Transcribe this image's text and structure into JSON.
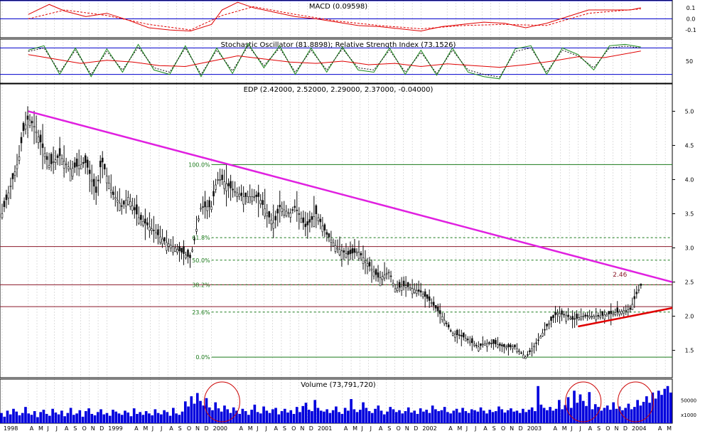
{
  "chart_data": [
    {
      "panel": "macd",
      "type": "line",
      "title": "MACD (0.09598)",
      "y_ticks": [
        "0.1",
        "0.0",
        "-0.1"
      ],
      "yticks_values": [
        0.1,
        0.0,
        -0.1
      ],
      "ylim": [
        -0.17,
        0.17
      ],
      "series": [
        {
          "style": "solid",
          "color": "#e00000",
          "x": [
            1998.25,
            1998.45,
            1998.6,
            1998.8,
            1999.0,
            1999.2,
            1999.4,
            1999.6,
            1999.8,
            2000.0,
            2000.1,
            2000.25,
            2000.4,
            2000.6,
            2000.8,
            2001.0,
            2001.2,
            2001.4,
            2001.6,
            2001.8,
            2002.0,
            2002.2,
            2002.4,
            2002.6,
            2002.8,
            2003.0,
            2003.2,
            2003.4,
            2003.6,
            2003.8,
            2004.0,
            2004.1
          ],
          "values": [
            0.04,
            0.13,
            0.07,
            0.02,
            0.05,
            -0.01,
            -0.08,
            -0.1,
            -0.11,
            -0.05,
            0.08,
            0.15,
            0.1,
            0.06,
            0.02,
            0.0,
            -0.03,
            -0.06,
            -0.07,
            -0.09,
            -0.11,
            -0.07,
            -0.05,
            -0.03,
            -0.04,
            -0.08,
            -0.04,
            0.02,
            0.08,
            0.08,
            0.08,
            0.1
          ]
        },
        {
          "style": "dashed",
          "color": "#e00000",
          "x": [
            1998.25,
            1998.6,
            1999.0,
            1999.4,
            1999.8,
            2000.1,
            2000.4,
            2000.8,
            2001.2,
            2001.6,
            2002.0,
            2002.4,
            2002.8,
            2003.2,
            2003.6,
            2004.1
          ],
          "values": [
            0.0,
            0.08,
            0.03,
            -0.05,
            -0.1,
            0.03,
            0.11,
            0.04,
            -0.02,
            -0.06,
            -0.09,
            -0.06,
            -0.05,
            -0.06,
            0.05,
            0.09
          ]
        }
      ]
    },
    {
      "panel": "oscillators",
      "type": "line",
      "title": "Stochastic Oscillator (81.8898); Relative Strength Index (73.1526)",
      "y_ticks": [
        "50"
      ],
      "yticks_values": [
        50
      ],
      "ylim": [
        0,
        100
      ],
      "reference_lines": [
        80,
        20
      ],
      "series": [
        {
          "style": "solid",
          "color": "#1a8a1a",
          "x": [
            1998.25,
            1998.4,
            1998.55,
            1998.7,
            1998.85,
            1999.0,
            1999.15,
            1999.3,
            1999.45,
            1999.6,
            1999.75,
            1999.9,
            2000.05,
            2000.2,
            2000.35,
            2000.5,
            2000.65,
            2000.8,
            2000.95,
            2001.1,
            2001.25,
            2001.4,
            2001.55,
            2001.7,
            2001.85,
            2002.0,
            2002.15,
            2002.3,
            2002.45,
            2002.6,
            2002.75,
            2002.9,
            2003.05,
            2003.2,
            2003.35,
            2003.5,
            2003.65,
            2003.8,
            2003.95,
            2004.1
          ],
          "values": [
            75,
            85,
            20,
            80,
            15,
            78,
            25,
            88,
            30,
            20,
            85,
            15,
            80,
            22,
            90,
            35,
            85,
            20,
            80,
            25,
            82,
            30,
            25,
            80,
            20,
            75,
            18,
            80,
            25,
            15,
            10,
            78,
            85,
            20,
            80,
            65,
            30,
            85,
            88,
            82
          ]
        },
        {
          "style": "dashed",
          "color": "#111111",
          "x": [
            1998.25,
            1998.4,
            1998.55,
            1998.7,
            1998.85,
            1999.0,
            1999.15,
            1999.3,
            1999.45,
            1999.6,
            1999.75,
            1999.9,
            2000.05,
            2000.2,
            2000.35,
            2000.5,
            2000.65,
            2000.8,
            2000.95,
            2001.1,
            2001.25,
            2001.4,
            2001.55,
            2001.7,
            2001.85,
            2002.0,
            2002.15,
            2002.3,
            2002.45,
            2002.6,
            2002.75,
            2002.9,
            2003.05,
            2003.2,
            2003.35,
            2003.5,
            2003.65,
            2003.8,
            2003.95,
            2004.1
          ],
          "values": [
            72,
            80,
            25,
            75,
            20,
            72,
            30,
            82,
            35,
            25,
            80,
            20,
            75,
            28,
            85,
            40,
            80,
            25,
            75,
            30,
            78,
            35,
            30,
            75,
            25,
            70,
            22,
            75,
            30,
            20,
            14,
            72,
            80,
            25,
            75,
            62,
            35,
            80,
            84,
            80
          ]
        },
        {
          "style": "solid",
          "color": "#e00000",
          "x": [
            1998.25,
            1998.5,
            1998.75,
            1999.0,
            1999.25,
            1999.5,
            1999.75,
            2000.0,
            2000.25,
            2000.5,
            2000.75,
            2001.0,
            2001.25,
            2001.5,
            2001.75,
            2002.0,
            2002.25,
            2002.5,
            2002.75,
            2003.0,
            2003.25,
            2003.5,
            2003.75,
            2004.1
          ],
          "values": [
            65,
            55,
            45,
            52,
            48,
            40,
            38,
            50,
            62,
            55,
            48,
            45,
            50,
            42,
            45,
            38,
            44,
            40,
            36,
            42,
            50,
            60,
            58,
            73
          ]
        }
      ]
    },
    {
      "panel": "price",
      "type": "candlestick",
      "title": "EDP (2.42000, 2.52000, 2.29000, 2.37000, -0.04000)",
      "y_ticks": [
        "1.5",
        "2.0",
        "2.5",
        "3.0",
        "3.5",
        "4.0",
        "4.5",
        "5.0"
      ],
      "yticks_values": [
        1.5,
        2.0,
        2.5,
        3.0,
        3.5,
        4.0,
        4.5,
        5.0
      ],
      "ylim": [
        1.1,
        5.4
      ],
      "close_path": {
        "x": [
          1998.0,
          1998.08,
          1998.16,
          1998.2,
          1998.25,
          1998.3,
          1998.38,
          1998.45,
          1998.55,
          1998.65,
          1998.8,
          1998.9,
          1998.95,
          1999.05,
          1999.15,
          1999.2,
          1999.3,
          1999.45,
          1999.55,
          1999.7,
          1999.8,
          1999.9,
          2000.0,
          2000.05,
          2000.1,
          2000.2,
          2000.3,
          2000.45,
          2000.55,
          2000.6,
          2000.65,
          2000.75,
          2000.8,
          2000.9,
          2001.0,
          2001.1,
          2001.2,
          2001.3,
          2001.4,
          2001.5,
          2001.6,
          2001.7,
          2001.75,
          2001.85,
          2002.0,
          2002.1,
          2002.2,
          2002.3,
          2002.4,
          2002.5,
          2002.55,
          2002.6,
          2002.7,
          2002.8,
          2002.9,
          2003.0,
          2003.1,
          2003.2,
          2003.3,
          2003.4,
          2003.45,
          2003.55,
          2003.7,
          2003.85,
          2004.0,
          2004.05,
          2004.1
        ],
        "values": [
          3.5,
          3.9,
          4.3,
          4.7,
          4.9,
          4.8,
          4.5,
          4.2,
          4.35,
          4.15,
          4.25,
          3.8,
          4.3,
          3.8,
          3.6,
          3.75,
          3.45,
          3.25,
          3.1,
          2.95,
          2.85,
          3.6,
          3.6,
          4.0,
          4.0,
          3.85,
          3.75,
          3.75,
          3.45,
          3.35,
          3.6,
          3.5,
          3.6,
          3.3,
          3.5,
          3.2,
          3.0,
          2.9,
          2.95,
          2.75,
          2.55,
          2.65,
          2.4,
          2.45,
          2.35,
          2.2,
          2.0,
          1.75,
          1.7,
          1.6,
          1.55,
          1.6,
          1.6,
          1.55,
          1.55,
          1.4,
          1.6,
          1.85,
          2.05,
          2.0,
          1.95,
          2.0,
          2.0,
          2.05,
          2.1,
          2.3,
          2.45
        ]
      },
      "trendline_resistance": {
        "x": [
          1998.25,
          2004.4
        ],
        "values": [
          5.0,
          2.5
        ],
        "color": "#e020e0"
      },
      "trendline_support": {
        "x": [
          2003.5,
          2004.4
        ],
        "values": [
          1.85,
          2.12
        ],
        "color": "#e00000"
      },
      "horizontal_levels": [
        {
          "value": 3.02,
          "color": "#8b1a2a"
        },
        {
          "value": 2.46,
          "color": "#8b1a2a"
        },
        {
          "value": 2.14,
          "color": "#8b1a2a"
        }
      ],
      "fibonacci": {
        "x_start": 2000.0,
        "levels": [
          {
            "label": "100.0%",
            "value": 4.22
          },
          {
            "label": "61.8%",
            "value": 3.15
          },
          {
            "label": "50.0%",
            "value": 2.82
          },
          {
            "label": "38.2%",
            "value": 2.46
          },
          {
            "label": "23.6%",
            "value": 2.06
          },
          {
            "label": "0.0%",
            "value": 1.4
          }
        ]
      },
      "annotation": {
        "text": "2.46",
        "x": 2003.9,
        "value": 2.58
      }
    },
    {
      "panel": "volume",
      "type": "bar",
      "title": "Volume (73,791,720)",
      "y_ticks": [
        "50000"
      ],
      "yticks_values": [
        50000
      ],
      "ylim": [
        0,
        95000
      ],
      "scale_note": "x1000",
      "bar_values": [
        22000,
        14000,
        27000,
        19000,
        31000,
        25000,
        17000,
        22000,
        35000,
        21000,
        18000,
        26000,
        13000,
        24000,
        29000,
        20000,
        16000,
        31000,
        23000,
        19000,
        27000,
        15000,
        22000,
        33000,
        18000,
        21000,
        28000,
        14000,
        26000,
        32000,
        20000,
        17000,
        24000,
        30000,
        19000,
        22000,
        16000,
        29000,
        25000,
        21000,
        18000,
        27000,
        23000,
        15000,
        32000,
        20000,
        24000,
        18000,
        26000,
        21000,
        17000,
        30000,
        22000,
        19000,
        28000,
        24000,
        16000,
        33000,
        21000,
        18000,
        25000,
        47000,
        36000,
        58000,
        42000,
        65000,
        48000,
        38000,
        54000,
        34000,
        28000,
        45000,
        32000,
        25000,
        38000,
        30000,
        22000,
        34000,
        27000,
        20000,
        31000,
        26000,
        18000,
        29000,
        40000,
        24000,
        21000,
        36000,
        27000,
        22000,
        30000,
        33000,
        19000,
        26000,
        31000,
        23000,
        28000,
        20000,
        35000,
        24000,
        37000,
        44000,
        29000,
        26000,
        50000,
        33000,
        27000,
        25000,
        30000,
        22000,
        28000,
        36000,
        24000,
        20000,
        33000,
        27000,
        52000,
        30000,
        24000,
        29000,
        45000,
        33000,
        26000,
        22000,
        31000,
        38000,
        27000,
        19000,
        25000,
        35000,
        30000,
        24000,
        28000,
        21000,
        26000,
        34000,
        23000,
        27000,
        20000,
        32000,
        25000,
        29000,
        22000,
        38000,
        30000,
        26000,
        28000,
        35000,
        24000,
        21000,
        27000,
        31000,
        23000,
        33000,
        26000,
        22000,
        30000,
        28000,
        25000,
        34000,
        27000,
        21000,
        29000,
        24000,
        26000,
        36000,
        30000,
        23000,
        28000,
        32000,
        25000,
        27000,
        22000,
        31000,
        24000,
        29000,
        34000,
        26000,
        80000,
        40000,
        33000,
        28000,
        35000,
        27000,
        31000,
        50000,
        30000,
        39000,
        56000,
        33000,
        70000,
        44000,
        62000,
        48000,
        37000,
        67000,
        30000,
        41000,
        35000,
        27000,
        33000,
        38000,
        29000,
        45000,
        31000,
        36000,
        28000,
        33000,
        42000,
        30000,
        35000,
        50000,
        38000,
        46000,
        58000,
        44000,
        66000,
        53000,
        70000,
        61000,
        74000,
        80000,
        66000
      ],
      "highlight_circles": [
        2000.1,
        2003.55,
        2004.05
      ]
    }
  ],
  "time_axis": {
    "labels": [
      {
        "text": "1998",
        "x": 1998.0
      },
      {
        "text": "A",
        "x": 1998.25
      },
      {
        "text": "M",
        "x": 1998.333
      },
      {
        "text": "J",
        "x": 1998.417
      },
      {
        "text": "J",
        "x": 1998.5
      },
      {
        "text": "A",
        "x": 1998.583
      },
      {
        "text": "S",
        "x": 1998.667
      },
      {
        "text": "O",
        "x": 1998.75
      },
      {
        "text": "N",
        "x": 1998.833
      },
      {
        "text": "D",
        "x": 1998.917
      },
      {
        "text": "1999",
        "x": 1999.0
      },
      {
        "text": "A",
        "x": 1999.25
      },
      {
        "text": "M",
        "x": 1999.333
      },
      {
        "text": "J",
        "x": 1999.417
      },
      {
        "text": "J",
        "x": 1999.5
      },
      {
        "text": "A",
        "x": 1999.583
      },
      {
        "text": "S",
        "x": 1999.667
      },
      {
        "text": "O",
        "x": 1999.75
      },
      {
        "text": "N",
        "x": 1999.833
      },
      {
        "text": "D",
        "x": 1999.917
      },
      {
        "text": "2000",
        "x": 2000.0
      },
      {
        "text": "A",
        "x": 2000.25
      },
      {
        "text": "M",
        "x": 2000.333
      },
      {
        "text": "J",
        "x": 2000.417
      },
      {
        "text": "J",
        "x": 2000.5
      },
      {
        "text": "A",
        "x": 2000.583
      },
      {
        "text": "S",
        "x": 2000.667
      },
      {
        "text": "O",
        "x": 2000.75
      },
      {
        "text": "N",
        "x": 2000.833
      },
      {
        "text": "D",
        "x": 2000.917
      },
      {
        "text": "2001",
        "x": 2001.0
      },
      {
        "text": "A",
        "x": 2001.25
      },
      {
        "text": "M",
        "x": 2001.333
      },
      {
        "text": "J",
        "x": 2001.417
      },
      {
        "text": "J",
        "x": 2001.5
      },
      {
        "text": "A",
        "x": 2001.583
      },
      {
        "text": "S",
        "x": 2001.667
      },
      {
        "text": "O",
        "x": 2001.75
      },
      {
        "text": "N",
        "x": 2001.833
      },
      {
        "text": "D",
        "x": 2001.917
      },
      {
        "text": "2002",
        "x": 2002.0
      },
      {
        "text": "A",
        "x": 2002.25
      },
      {
        "text": "M",
        "x": 2002.333
      },
      {
        "text": "J",
        "x": 2002.417
      },
      {
        "text": "J",
        "x": 2002.5
      },
      {
        "text": "A",
        "x": 2002.583
      },
      {
        "text": "S",
        "x": 2002.667
      },
      {
        "text": "O",
        "x": 2002.75
      },
      {
        "text": "N",
        "x": 2002.833
      },
      {
        "text": "D",
        "x": 2002.917
      },
      {
        "text": "2003",
        "x": 2003.0
      },
      {
        "text": "A",
        "x": 2003.25
      },
      {
        "text": "M",
        "x": 2003.333
      },
      {
        "text": "J",
        "x": 2003.417
      },
      {
        "text": "J",
        "x": 2003.5
      },
      {
        "text": "A",
        "x": 2003.583
      },
      {
        "text": "S",
        "x": 2003.667
      },
      {
        "text": "O",
        "x": 2003.75
      },
      {
        "text": "N",
        "x": 2003.833
      },
      {
        "text": "D",
        "x": 2003.917
      },
      {
        "text": "2004",
        "x": 2004.0
      },
      {
        "text": "A",
        "x": 2004.25
      },
      {
        "text": "M",
        "x": 2004.333
      }
    ],
    "range": [
      1997.98,
      2004.4
    ]
  },
  "colors": {
    "background": "#ffffff",
    "grid": "#c8c8c8",
    "blue_line": "#0000cc",
    "fib": "#1a7a1a",
    "candle": "#111111",
    "volume": "#0000dd",
    "circle": "#cc0000",
    "text": "#000000"
  }
}
